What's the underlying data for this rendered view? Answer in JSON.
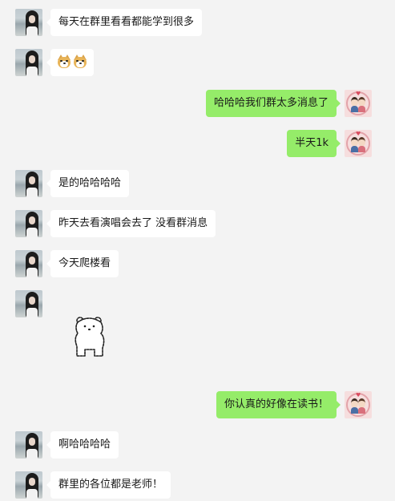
{
  "messages": [
    {
      "side": "left",
      "avatar": "girl-avatar",
      "text": "每天在群里看看都能学到很多"
    },
    {
      "side": "left",
      "avatar": "girl-avatar",
      "emoji": "dog-face-emoji x2"
    },
    {
      "side": "right",
      "avatar": "couple-avatar",
      "text": "哈哈哈我们群太多消息了"
    },
    {
      "side": "right",
      "avatar": "couple-avatar",
      "text": "半天1k"
    },
    {
      "side": "left",
      "avatar": "girl-avatar",
      "text": "是的哈哈哈哈"
    },
    {
      "side": "left",
      "avatar": "girl-avatar",
      "text": "昨天去看演唱会去了 没看群消息"
    },
    {
      "side": "left",
      "avatar": "girl-avatar",
      "text": "今天爬楼看"
    },
    {
      "side": "left",
      "avatar": "girl-avatar",
      "sticker": "bear-sticker"
    },
    {
      "side": "right",
      "avatar": "couple-avatar",
      "text": "你认真的好像在读书！"
    },
    {
      "side": "left",
      "avatar": "girl-avatar",
      "text": "啊哈哈哈哈"
    },
    {
      "side": "left",
      "avatar": "girl-avatar",
      "text": "群里的各位都是老师！"
    }
  ],
  "colors": {
    "background": "#f3f3f3",
    "incoming_bubble": "#ffffff",
    "outgoing_bubble": "#95ec69",
    "text": "#191919"
  }
}
